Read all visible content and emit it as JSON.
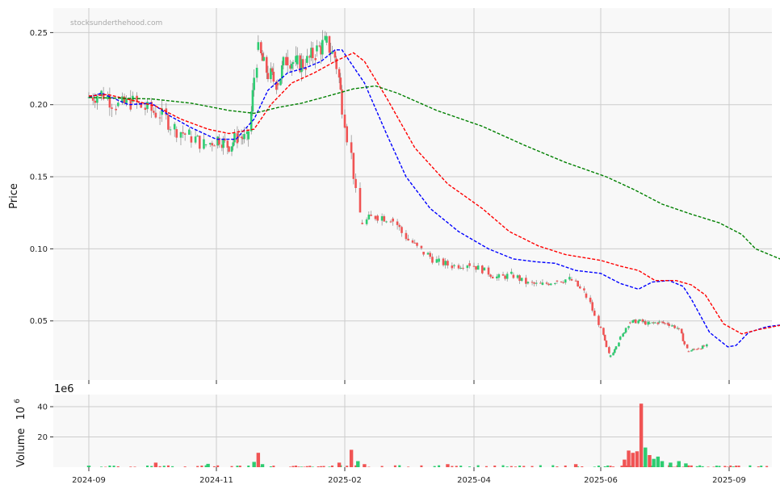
{
  "chart_data": [
    {
      "type": "candlestick",
      "watermark": "stocksunderthehood.com",
      "ylabel": "Price",
      "ylim": [
        0.009,
        0.267
      ],
      "yticks": [
        "0.05",
        "0.10",
        "0.15",
        "0.20",
        "0.25"
      ],
      "xticks": [
        "2024-09",
        "2024-11",
        "2025-02",
        "2025-04",
        "2025-06",
        "2025-09"
      ],
      "grid": true,
      "colors": {
        "up": "#2ecc71",
        "down": "#f05454",
        "ma_short": "#0000ff",
        "ma_mid": "#ff0000",
        "ma_long": "#008000",
        "panel_bg": "#f8f8f8",
        "grid": "#cccccc"
      },
      "close_path": [
        [
          "2024-09-01",
          0.205
        ],
        [
          "2024-09-08",
          0.208
        ],
        [
          "2024-09-15",
          0.199
        ],
        [
          "2024-09-22",
          0.202
        ],
        [
          "2024-09-29",
          0.197
        ],
        [
          "2024-10-06",
          0.193
        ],
        [
          "2024-10-13",
          0.183
        ],
        [
          "2024-10-20",
          0.178
        ],
        [
          "2024-10-27",
          0.172
        ],
        [
          "2024-11-03",
          0.177
        ],
        [
          "2024-11-10",
          0.171
        ],
        [
          "2024-11-17",
          0.178
        ],
        [
          "2024-11-24",
          0.176
        ],
        [
          "2024-12-01",
          0.238
        ],
        [
          "2024-12-08",
          0.222
        ],
        [
          "2024-12-15",
          0.215
        ],
        [
          "2024-12-22",
          0.233
        ],
        [
          "2024-12-29",
          0.228
        ],
        [
          "2025-01-05",
          0.229
        ],
        [
          "2025-01-12",
          0.237
        ],
        [
          "2025-01-19",
          0.243
        ],
        [
          "2025-01-26",
          0.232
        ],
        [
          "2025-02-02",
          0.185
        ],
        [
          "2025-02-09",
          0.118
        ],
        [
          "2025-02-16",
          0.123
        ],
        [
          "2025-02-23",
          0.121
        ],
        [
          "2025-03-02",
          0.107
        ],
        [
          "2025-03-09",
          0.098
        ],
        [
          "2025-03-16",
          0.091
        ],
        [
          "2025-03-23",
          0.088
        ],
        [
          "2025-03-30",
          0.09
        ],
        [
          "2025-04-06",
          0.085
        ],
        [
          "2025-04-13",
          0.08
        ],
        [
          "2025-04-20",
          0.082
        ],
        [
          "2025-04-27",
          0.076
        ],
        [
          "2025-05-04",
          0.075
        ],
        [
          "2025-05-11",
          0.078
        ],
        [
          "2025-05-18",
          0.079
        ],
        [
          "2025-05-25",
          0.069
        ],
        [
          "2025-06-01",
          0.046
        ],
        [
          "2025-06-08",
          0.025
        ],
        [
          "2025-06-15",
          0.037
        ],
        [
          "2025-06-22",
          0.049
        ],
        [
          "2025-06-29",
          0.05
        ],
        [
          "2025-07-06",
          0.048
        ],
        [
          "2025-07-13",
          0.049
        ],
        [
          "2025-07-20",
          0.048
        ],
        [
          "2025-07-27",
          0.045
        ],
        [
          "2025-08-03",
          0.029
        ],
        [
          "2025-08-10",
          0.031
        ],
        [
          "2025-08-17",
          0.033
        ]
      ],
      "series": [
        {
          "color": "#0000ff",
          "dashed": true,
          "points": [
            [
              "2024-09-01",
              0.205
            ],
            [
              "2024-09-07",
              0.208
            ],
            [
              "2024-09-20",
              0.2
            ],
            [
              "2024-10-01",
              0.201
            ],
            [
              "2024-10-10",
              0.192
            ],
            [
              "2024-10-20",
              0.184
            ],
            [
              "2024-11-01",
              0.176
            ],
            [
              "2024-11-15",
              0.176
            ],
            [
              "2024-11-28",
              0.19
            ],
            [
              "2024-12-08",
              0.21
            ],
            [
              "2024-12-22",
              0.222
            ],
            [
              "2025-01-05",
              0.226
            ],
            [
              "2025-01-15",
              0.23
            ],
            [
              "2025-01-25",
              0.238
            ],
            [
              "2025-01-30",
              0.238
            ],
            [
              "2025-02-10",
              0.215
            ],
            [
              "2025-02-20",
              0.18
            ],
            [
              "2025-03-01",
              0.15
            ],
            [
              "2025-03-12",
              0.128
            ],
            [
              "2025-03-25",
              0.112
            ],
            [
              "2025-04-08",
              0.1
            ],
            [
              "2025-04-20",
              0.093
            ],
            [
              "2025-05-01",
              0.091
            ],
            [
              "2025-05-10",
              0.09
            ],
            [
              "2025-05-20",
              0.085
            ],
            [
              "2025-06-01",
              0.083
            ],
            [
              "2025-06-15",
              0.076
            ],
            [
              "2025-06-28",
              0.072
            ],
            [
              "2025-07-08",
              0.077
            ],
            [
              "2025-07-20",
              0.078
            ],
            [
              "2025-07-30",
              0.074
            ],
            [
              "2025-08-05",
              0.065
            ],
            [
              "2025-08-18",
              0.042
            ],
            [
              "2025-08-31",
              0.032
            ],
            [
              "2025-09-06",
              0.033
            ],
            [
              "2025-09-15",
              0.042
            ],
            [
              "2025-09-28",
              0.046
            ],
            [
              "2025-10-15",
              0.048
            ],
            [
              "2025-10-28",
              0.046
            ],
            [
              "2025-11-08",
              0.04
            ],
            [
              "2025-11-16",
              0.033
            ],
            [
              "2025-11-24",
              0.034
            ]
          ]
        },
        {
          "color": "#ff0000",
          "dashed": true,
          "points": [
            [
              "2024-09-01",
              0.206
            ],
            [
              "2024-09-10",
              0.207
            ],
            [
              "2024-09-22",
              0.203
            ],
            [
              "2024-10-03",
              0.199
            ],
            [
              "2024-10-15",
              0.19
            ],
            [
              "2024-10-28",
              0.183
            ],
            [
              "2024-11-10",
              0.18
            ],
            [
              "2024-11-28",
              0.183
            ],
            [
              "2024-12-10",
              0.2
            ],
            [
              "2024-12-25",
              0.215
            ],
            [
              "2025-01-10",
              0.222
            ],
            [
              "2025-01-25",
              0.23
            ],
            [
              "2025-02-05",
              0.236
            ],
            [
              "2025-02-10",
              0.23
            ],
            [
              "2025-02-20",
              0.205
            ],
            [
              "2025-03-05",
              0.17
            ],
            [
              "2025-03-20",
              0.145
            ],
            [
              "2025-04-05",
              0.128
            ],
            [
              "2025-04-18",
              0.112
            ],
            [
              "2025-05-02",
              0.102
            ],
            [
              "2025-05-15",
              0.096
            ],
            [
              "2025-06-01",
              0.092
            ],
            [
              "2025-06-15",
              0.088
            ],
            [
              "2025-06-28",
              0.085
            ],
            [
              "2025-07-10",
              0.078
            ],
            [
              "2025-07-25",
              0.078
            ],
            [
              "2025-08-05",
              0.075
            ],
            [
              "2025-08-15",
              0.068
            ],
            [
              "2025-08-28",
              0.048
            ],
            [
              "2025-09-10",
              0.041
            ],
            [
              "2025-09-22",
              0.044
            ],
            [
              "2025-10-08",
              0.047
            ],
            [
              "2025-10-25",
              0.047
            ],
            [
              "2025-11-10",
              0.043
            ],
            [
              "2025-11-20",
              0.037
            ],
            [
              "2025-11-28",
              0.036
            ]
          ]
        },
        {
          "color": "#008000",
          "dashed": true,
          "points": [
            [
              "2024-09-01",
              0.205
            ],
            [
              "2024-10-01",
              0.204
            ],
            [
              "2024-10-20",
              0.201
            ],
            [
              "2024-11-10",
              0.196
            ],
            [
              "2024-11-28",
              0.194
            ],
            [
              "2024-12-15",
              0.198
            ],
            [
              "2025-01-01",
              0.201
            ],
            [
              "2025-01-20",
              0.206
            ],
            [
              "2025-02-05",
              0.211
            ],
            [
              "2025-02-15",
              0.213
            ],
            [
              "2025-02-25",
              0.208
            ],
            [
              "2025-03-15",
              0.196
            ],
            [
              "2025-04-05",
              0.185
            ],
            [
              "2025-04-25",
              0.172
            ],
            [
              "2025-05-15",
              0.16
            ],
            [
              "2025-06-05",
              0.15
            ],
            [
              "2025-06-25",
              0.141
            ],
            [
              "2025-07-15",
              0.131
            ],
            [
              "2025-08-05",
              0.124
            ],
            [
              "2025-08-25",
              0.118
            ],
            [
              "2025-09-10",
              0.11
            ],
            [
              "2025-09-20",
              0.1
            ],
            [
              "2025-10-10",
              0.092
            ],
            [
              "2025-11-01",
              0.086
            ],
            [
              "2025-11-25",
              0.079
            ],
            [
              "2025-12-20",
              0.073
            ],
            [
              "2026-01-15",
              0.066
            ]
          ]
        }
      ]
    },
    {
      "type": "bar",
      "ylabel": "Volume",
      "offset_label": "1e6",
      "unit_power": "10",
      "unit_exponent": "6",
      "yticks": [
        "20",
        "40"
      ],
      "ylim": [
        0,
        48
      ],
      "xticks": [
        "2024-09",
        "2024-11",
        "2025-02",
        "2025-04",
        "2025-06",
        "2025-09"
      ],
      "spikes": [
        [
          "2024-09-01",
          1.0,
          "up"
        ],
        [
          "2024-10-03",
          3.0,
          "down"
        ],
        [
          "2024-10-28",
          2.2,
          "up"
        ],
        [
          "2024-11-28",
          3.5,
          "up"
        ],
        [
          "2024-12-01",
          9.5,
          "down"
        ],
        [
          "2024-12-04",
          2.0,
          "up"
        ],
        [
          "2025-01-28",
          3.0,
          "down"
        ],
        [
          "2025-02-04",
          11.5,
          "down"
        ],
        [
          "2025-02-07",
          4.0,
          "up"
        ],
        [
          "2025-02-10",
          2.0,
          "down"
        ],
        [
          "2025-03-20",
          2.0,
          "down"
        ],
        [
          "2025-05-20",
          2.0,
          "down"
        ],
        [
          "2025-06-18",
          5.0,
          "down"
        ],
        [
          "2025-06-21",
          11.0,
          "down"
        ],
        [
          "2025-06-24",
          9.5,
          "down"
        ],
        [
          "2025-06-27",
          10.5,
          "down"
        ],
        [
          "2025-06-30",
          42.0,
          "down"
        ],
        [
          "2025-07-03",
          13.0,
          "up"
        ],
        [
          "2025-07-06",
          8.0,
          "down"
        ],
        [
          "2025-07-09",
          5.5,
          "up"
        ],
        [
          "2025-07-12",
          7.0,
          "up"
        ],
        [
          "2025-07-15",
          4.0,
          "up"
        ],
        [
          "2025-07-21",
          3.0,
          "up"
        ],
        [
          "2025-07-27",
          4.0,
          "up"
        ],
        [
          "2025-08-01",
          2.5,
          "up"
        ],
        [
          "2025-10-10",
          2.0,
          "down"
        ],
        [
          "2025-11-05",
          9.5,
          "down"
        ],
        [
          "2025-11-08",
          3.5,
          "down"
        ],
        [
          "2025-11-11",
          1.2,
          "up"
        ]
      ]
    }
  ]
}
